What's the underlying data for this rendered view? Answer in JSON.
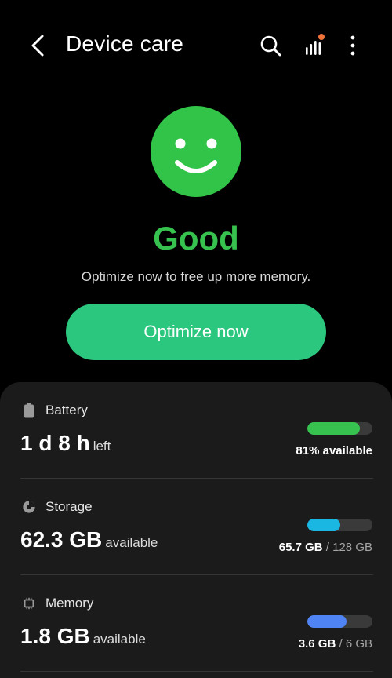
{
  "header": {
    "title": "Device care"
  },
  "status": {
    "label": "Good",
    "message": "Optimize now to free up more memory.",
    "button_label": "Optimize now"
  },
  "colors": {
    "good_green": "#37c24f",
    "button_green": "#2cc77e",
    "battery_bar": "#37c24f",
    "storage_bar": "#1bb7e3",
    "memory_bar": "#4f84f5",
    "notification_dot": "#f0743a"
  },
  "cards": [
    {
      "label": "Battery",
      "icon": "battery-icon",
      "value": "1 d 8 h",
      "unit": "left",
      "level": 0.81,
      "note_main": "81% available",
      "note_sep": "",
      "note_total": ""
    },
    {
      "label": "Storage",
      "icon": "storage-pie-icon",
      "value": "62.3 GB",
      "unit": "available",
      "level": 0.51,
      "note_main": "65.7 GB",
      "note_sep": " / ",
      "note_total": "128 GB"
    },
    {
      "label": "Memory",
      "icon": "memory-chip-icon",
      "value": "1.8 GB",
      "unit": "available",
      "level": 0.6,
      "note_main": "3.6 GB",
      "note_sep": " / ",
      "note_total": "6 GB"
    }
  ]
}
